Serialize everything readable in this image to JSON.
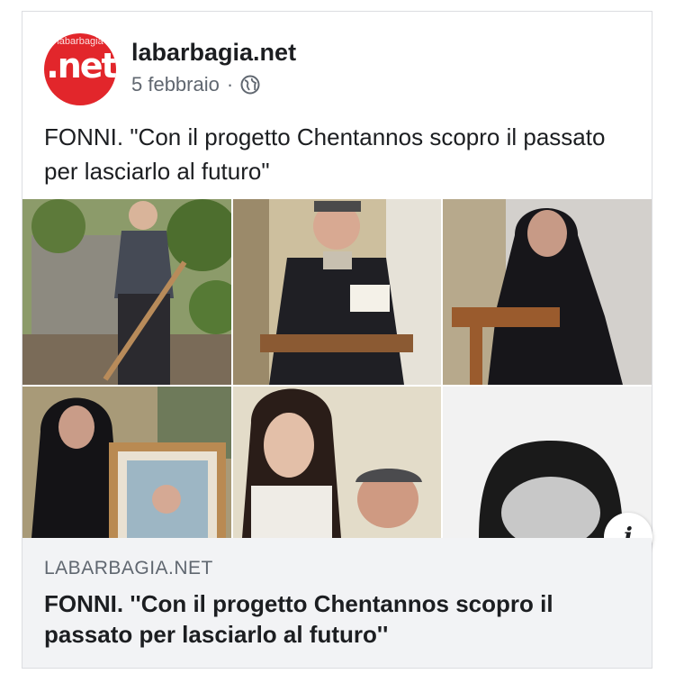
{
  "post": {
    "page_name": "labarbagia.net",
    "date": "5 febbraio",
    "separator": "·",
    "text": "FONNI. \"Con il progetto Chentannos scopro il passato per lasciarlo al futuro\"",
    "avatar": {
      "top_text": "labarbagia",
      "logo_text": ".net",
      "color": "#e2262b"
    }
  },
  "link_preview": {
    "domain": "LABARBAGIA.NET",
    "title": "FONNI. ''Con il progetto Chentannos scopro il passato per lasciarlo al futuro''"
  },
  "icons": {
    "privacy": "globe-icon",
    "info": "info-icon",
    "info_glyph": "i"
  },
  "colors": {
    "text_primary": "#1c1e21",
    "text_secondary": "#606770",
    "link_box_bg": "#f2f3f5"
  }
}
